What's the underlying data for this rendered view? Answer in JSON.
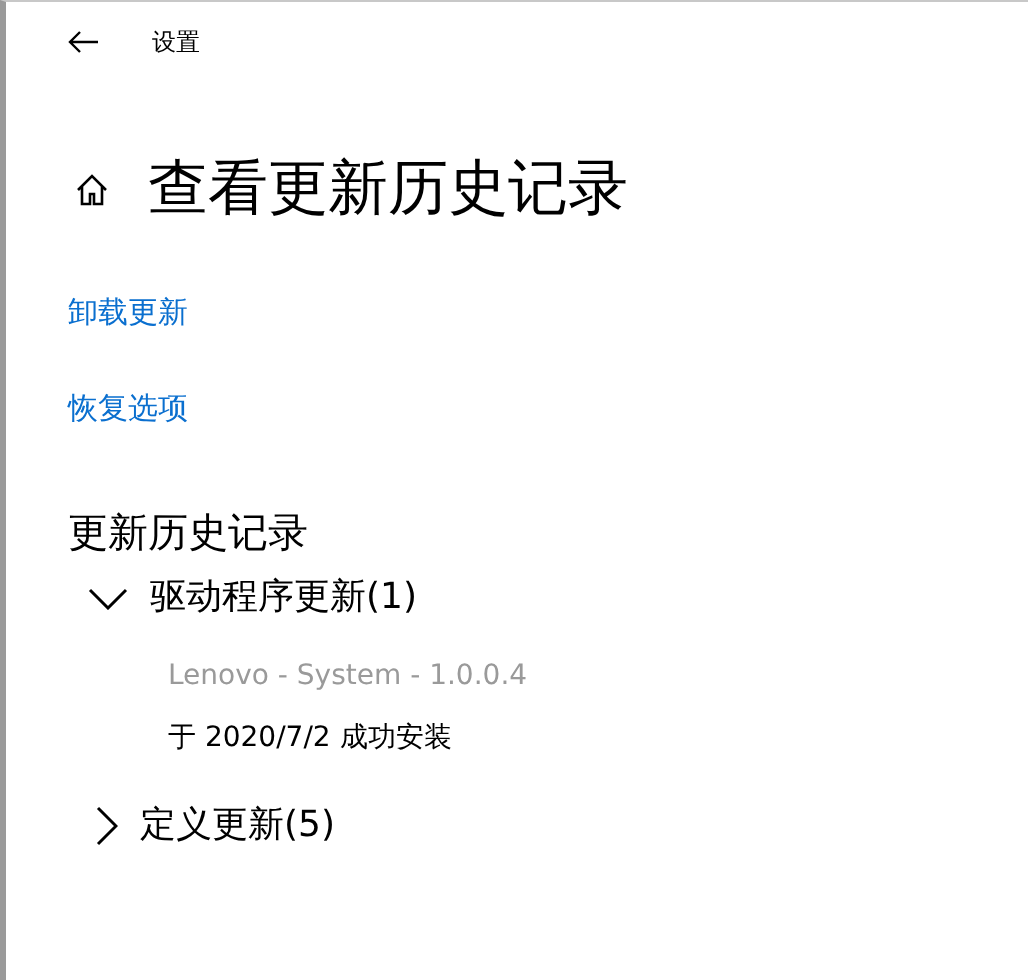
{
  "window": {
    "title": "设置"
  },
  "page": {
    "title": "查看更新历史记录"
  },
  "links": [
    "卸载更新",
    "恢复选项"
  ],
  "history": {
    "title": "更新历史记录",
    "groups": [
      {
        "label": "驱动程序更新(1)",
        "expanded": true,
        "items": [
          {
            "name": "Lenovo - System - 1.0.0.4",
            "status": "于 2020/7/2 成功安装"
          }
        ]
      },
      {
        "label": "定义更新(5)",
        "expanded": false
      }
    ]
  }
}
